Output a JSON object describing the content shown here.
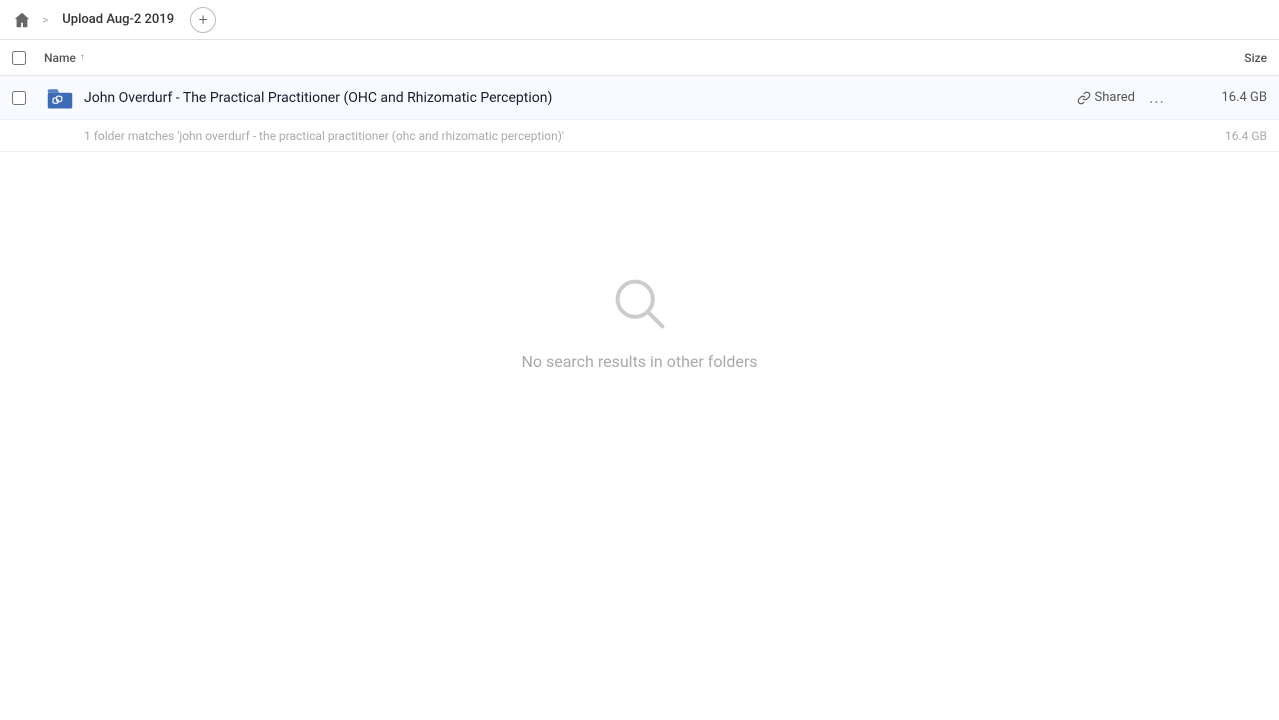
{
  "topbar": {
    "home_label": "Home",
    "breadcrumb_separator": ">",
    "breadcrumb_label": "Upload Aug-2 2019",
    "add_button_label": "+"
  },
  "columns": {
    "name_label": "Name",
    "sort_indicator": "↑",
    "size_label": "Size"
  },
  "file_row": {
    "name": "John Overdurf - The Practical Practitioner (OHC and Rhizomatic Perception)",
    "shared_label": "Shared",
    "size": "16.4 GB",
    "more_label": "..."
  },
  "summary": {
    "text": "1 folder matches 'john overdurf - the practical practitioner (ohc and rhizomatic perception)'",
    "size": "16.4 GB"
  },
  "empty_state": {
    "message": "No search results in other folders"
  },
  "colors": {
    "accent": "#4a6cf7",
    "icon_bg": "#3d6bb5",
    "shared_color": "#555555",
    "link_icon": "#3d6bb5"
  }
}
